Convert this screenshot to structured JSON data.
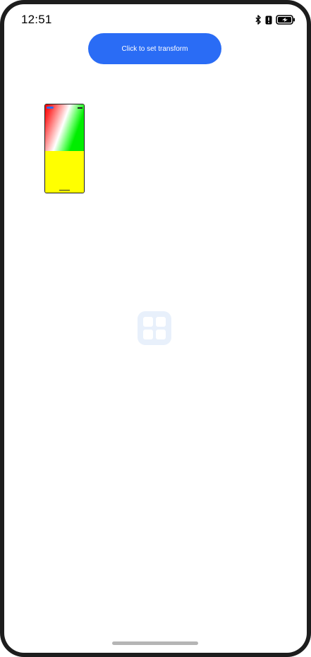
{
  "status_bar": {
    "time": "12:51",
    "icons": [
      "bluetooth-icon",
      "alert-icon",
      "battery-charging-icon"
    ]
  },
  "main": {
    "action_button_label": "Click to set transform",
    "preview": {
      "description_colors": {
        "top_gradient": [
          "#ff0000",
          "#ffffff",
          "#00ee00"
        ],
        "bottom_fill": "#ffff00",
        "accent": "#2a6cf5"
      }
    },
    "placeholder_icon": "grid-icon"
  },
  "colors": {
    "accent": "#2a6cf5",
    "frame": "#1d1d1d",
    "background": "#ffffff",
    "placeholder": "#e8f0fb",
    "home_indicator": "#b5b5b5"
  }
}
